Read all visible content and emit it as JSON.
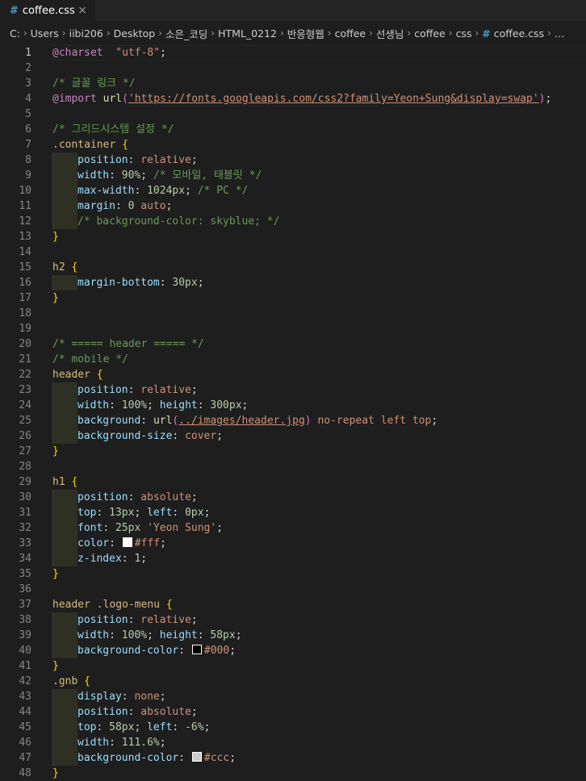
{
  "tab": {
    "title": "coffee.css",
    "close": "×"
  },
  "breadcrumb": [
    "C:",
    "Users",
    "iibi206",
    "Desktop",
    "소은_코딩",
    "HTML_0212",
    "반응형웹",
    "coffee",
    "선생님",
    "coffee",
    "css",
    "coffee.css"
  ],
  "breadcrumb_more": "…",
  "colors": {
    "white": "#ffffff",
    "black": "#000000",
    "grey": "#cccccc"
  },
  "lines": [
    {
      "n": "1",
      "t": [
        [
          "at",
          "@charset"
        ],
        [
          "",
          "  "
        ],
        [
          "str",
          "\"utf-8\""
        ],
        [
          "",
          ";"
        ]
      ]
    },
    {
      "n": "2",
      "t": []
    },
    {
      "n": "3",
      "t": [
        [
          "cmt",
          "/* 글꼴 링크 */"
        ]
      ]
    },
    {
      "n": "4",
      "t": [
        [
          "at",
          "@import"
        ],
        [
          "",
          " "
        ],
        [
          "fn",
          "url"
        ],
        [
          "br2",
          "("
        ],
        [
          "url",
          "'https://fonts.googleapis.com/css2?family=Yeon+Sung&display=swap'"
        ],
        [
          "br2",
          ")"
        ],
        [
          "",
          ";"
        ]
      ]
    },
    {
      "n": "5",
      "t": []
    },
    {
      "n": "6",
      "t": [
        [
          "cmt",
          "/* 그리드시스템 설정 */"
        ]
      ]
    },
    {
      "n": "7",
      "t": [
        [
          "sel",
          ".container"
        ],
        [
          "",
          " "
        ],
        [
          "br",
          "{"
        ]
      ]
    },
    {
      "n": "8",
      "i": 1,
      "t": [
        [
          "prop",
          "position"
        ],
        [
          "",
          ": "
        ],
        [
          "val",
          "relative"
        ],
        [
          "",
          ";"
        ]
      ]
    },
    {
      "n": "9",
      "i": 1,
      "t": [
        [
          "prop",
          "width"
        ],
        [
          "",
          ": "
        ],
        [
          "num",
          "90%"
        ],
        [
          "",
          "; "
        ],
        [
          "cmt",
          "/* 모바일, 태블릿 */"
        ]
      ]
    },
    {
      "n": "10",
      "i": 1,
      "t": [
        [
          "prop",
          "max-width"
        ],
        [
          "",
          ": "
        ],
        [
          "num",
          "1024px"
        ],
        [
          "",
          "; "
        ],
        [
          "cmt",
          "/* PC */"
        ]
      ]
    },
    {
      "n": "11",
      "i": 1,
      "t": [
        [
          "prop",
          "margin"
        ],
        [
          "",
          ": "
        ],
        [
          "num",
          "0"
        ],
        [
          "",
          " "
        ],
        [
          "val",
          "auto"
        ],
        [
          "",
          ";"
        ]
      ]
    },
    {
      "n": "12",
      "i": 1,
      "t": [
        [
          "cmt",
          "/* background-color: skyblue; */"
        ]
      ]
    },
    {
      "n": "13",
      "t": [
        [
          "br",
          "}"
        ]
      ]
    },
    {
      "n": "14",
      "t": []
    },
    {
      "n": "15",
      "t": [
        [
          "tag",
          "h2"
        ],
        [
          "",
          " "
        ],
        [
          "br",
          "{"
        ]
      ]
    },
    {
      "n": "16",
      "i": 1,
      "t": [
        [
          "prop",
          "margin-bottom"
        ],
        [
          "",
          ": "
        ],
        [
          "num",
          "30px"
        ],
        [
          "",
          ";"
        ]
      ]
    },
    {
      "n": "17",
      "t": [
        [
          "br",
          "}"
        ]
      ]
    },
    {
      "n": "18",
      "t": []
    },
    {
      "n": "19",
      "t": []
    },
    {
      "n": "20",
      "t": [
        [
          "cmt",
          "/* ===== header ===== */"
        ]
      ]
    },
    {
      "n": "21",
      "t": [
        [
          "cmt",
          "/* mobile */"
        ]
      ]
    },
    {
      "n": "22",
      "t": [
        [
          "tag",
          "header"
        ],
        [
          "",
          " "
        ],
        [
          "br",
          "{"
        ]
      ]
    },
    {
      "n": "23",
      "i": 1,
      "t": [
        [
          "prop",
          "position"
        ],
        [
          "",
          ": "
        ],
        [
          "val",
          "relative"
        ],
        [
          "",
          ";"
        ]
      ]
    },
    {
      "n": "24",
      "i": 1,
      "t": [
        [
          "prop",
          "width"
        ],
        [
          "",
          ": "
        ],
        [
          "num",
          "100%"
        ],
        [
          "",
          "; "
        ],
        [
          "prop",
          "height"
        ],
        [
          "",
          ": "
        ],
        [
          "num",
          "300px"
        ],
        [
          "",
          ";"
        ]
      ]
    },
    {
      "n": "25",
      "i": 1,
      "t": [
        [
          "prop",
          "background"
        ],
        [
          "",
          ": "
        ],
        [
          "fn",
          "url"
        ],
        [
          "br2",
          "("
        ],
        [
          "url",
          "../images/header.jpg"
        ],
        [
          "br2",
          ")"
        ],
        [
          "",
          " "
        ],
        [
          "val",
          "no-repeat left top"
        ],
        [
          "",
          ";"
        ]
      ]
    },
    {
      "n": "26",
      "i": 1,
      "t": [
        [
          "prop",
          "background-size"
        ],
        [
          "",
          ": "
        ],
        [
          "val",
          "cover"
        ],
        [
          "",
          ";"
        ]
      ]
    },
    {
      "n": "27",
      "t": [
        [
          "br",
          "}"
        ]
      ]
    },
    {
      "n": "28",
      "t": []
    },
    {
      "n": "29",
      "t": [
        [
          "tag",
          "h1"
        ],
        [
          "",
          " "
        ],
        [
          "br",
          "{"
        ]
      ]
    },
    {
      "n": "30",
      "i": 1,
      "t": [
        [
          "prop",
          "position"
        ],
        [
          "",
          ": "
        ],
        [
          "val",
          "absolute"
        ],
        [
          "",
          ";"
        ]
      ]
    },
    {
      "n": "31",
      "i": 1,
      "t": [
        [
          "prop",
          "top"
        ],
        [
          "",
          ": "
        ],
        [
          "num",
          "13px"
        ],
        [
          "",
          "; "
        ],
        [
          "prop",
          "left"
        ],
        [
          "",
          ": "
        ],
        [
          "num",
          "0px"
        ],
        [
          "",
          ";"
        ]
      ]
    },
    {
      "n": "32",
      "i": 1,
      "t": [
        [
          "prop",
          "font"
        ],
        [
          "",
          ": "
        ],
        [
          "num",
          "25px"
        ],
        [
          "",
          " "
        ],
        [
          "str",
          "'Yeon Sung'"
        ],
        [
          "",
          ";"
        ]
      ]
    },
    {
      "n": "33",
      "i": 1,
      "t": [
        [
          "prop",
          "color"
        ],
        [
          "",
          ": "
        ],
        [
          "sw",
          "white"
        ],
        [
          "val",
          "#fff"
        ],
        [
          "",
          ";"
        ]
      ]
    },
    {
      "n": "34",
      "i": 1,
      "t": [
        [
          "prop",
          "z-index"
        ],
        [
          "",
          ": "
        ],
        [
          "num",
          "1"
        ],
        [
          "",
          ";"
        ]
      ]
    },
    {
      "n": "35",
      "t": [
        [
          "br",
          "}"
        ]
      ]
    },
    {
      "n": "36",
      "t": []
    },
    {
      "n": "37",
      "t": [
        [
          "tag",
          "header"
        ],
        [
          "",
          " "
        ],
        [
          "sel",
          ".logo-menu"
        ],
        [
          "",
          " "
        ],
        [
          "br",
          "{"
        ]
      ]
    },
    {
      "n": "38",
      "i": 1,
      "t": [
        [
          "prop",
          "position"
        ],
        [
          "",
          ": "
        ],
        [
          "val",
          "relative"
        ],
        [
          "",
          ";"
        ]
      ]
    },
    {
      "n": "39",
      "i": 1,
      "t": [
        [
          "prop",
          "width"
        ],
        [
          "",
          ": "
        ],
        [
          "num",
          "100%"
        ],
        [
          "",
          "; "
        ],
        [
          "prop",
          "height"
        ],
        [
          "",
          ": "
        ],
        [
          "num",
          "58px"
        ],
        [
          "",
          ";"
        ]
      ]
    },
    {
      "n": "40",
      "i": 1,
      "t": [
        [
          "prop",
          "background-color"
        ],
        [
          "",
          ": "
        ],
        [
          "sw",
          "black"
        ],
        [
          "val",
          "#000"
        ],
        [
          "",
          ";"
        ]
      ]
    },
    {
      "n": "41",
      "t": [
        [
          "br",
          "}"
        ]
      ]
    },
    {
      "n": "42",
      "t": [
        [
          "sel",
          ".gnb"
        ],
        [
          "",
          " "
        ],
        [
          "br",
          "{"
        ]
      ]
    },
    {
      "n": "43",
      "i": 1,
      "t": [
        [
          "prop",
          "display"
        ],
        [
          "",
          ": "
        ],
        [
          "val",
          "none"
        ],
        [
          "",
          ";"
        ]
      ]
    },
    {
      "n": "44",
      "i": 1,
      "t": [
        [
          "prop",
          "position"
        ],
        [
          "",
          ": "
        ],
        [
          "val",
          "absolute"
        ],
        [
          "",
          ";"
        ]
      ]
    },
    {
      "n": "45",
      "i": 1,
      "t": [
        [
          "prop",
          "top"
        ],
        [
          "",
          ": "
        ],
        [
          "num",
          "58px"
        ],
        [
          "",
          "; "
        ],
        [
          "prop",
          "left"
        ],
        [
          "",
          ": "
        ],
        [
          "num",
          "-6%"
        ],
        [
          "",
          ";"
        ]
      ]
    },
    {
      "n": "46",
      "i": 1,
      "t": [
        [
          "prop",
          "width"
        ],
        [
          "",
          ": "
        ],
        [
          "num",
          "111.6%"
        ],
        [
          "",
          ";"
        ]
      ]
    },
    {
      "n": "47",
      "i": 1,
      "t": [
        [
          "prop",
          "background-color"
        ],
        [
          "",
          ": "
        ],
        [
          "sw",
          "grey"
        ],
        [
          "val",
          "#ccc"
        ],
        [
          "",
          ";"
        ]
      ]
    },
    {
      "n": "48",
      "t": [
        [
          "br",
          "}"
        ]
      ]
    }
  ]
}
